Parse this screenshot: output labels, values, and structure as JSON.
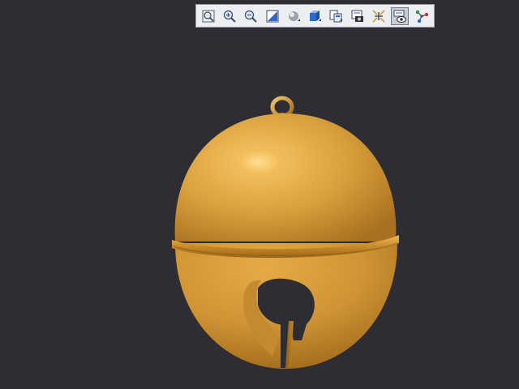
{
  "toolbar": {
    "buttons": [
      {
        "icon": "zoom-fit-icon"
      },
      {
        "icon": "zoom-in-icon"
      },
      {
        "icon": "zoom-out-icon"
      },
      {
        "icon": "zoom-window-icon"
      },
      {
        "icon": "shading-icon"
      },
      {
        "icon": "view-cube-icon"
      },
      {
        "icon": "view-layout-icon"
      },
      {
        "icon": "snapshot-icon"
      },
      {
        "icon": "explode-icon"
      },
      {
        "icon": "visibility-icon",
        "active": true
      },
      {
        "icon": "connection-icon"
      }
    ]
  },
  "colors": {
    "background": "#2d2d33",
    "bell_base": "#d89e3a",
    "bell_highlight": "#ffdd8a",
    "bell_shadow": "#8a5c16",
    "toolbar_bg": "#eceef2"
  }
}
